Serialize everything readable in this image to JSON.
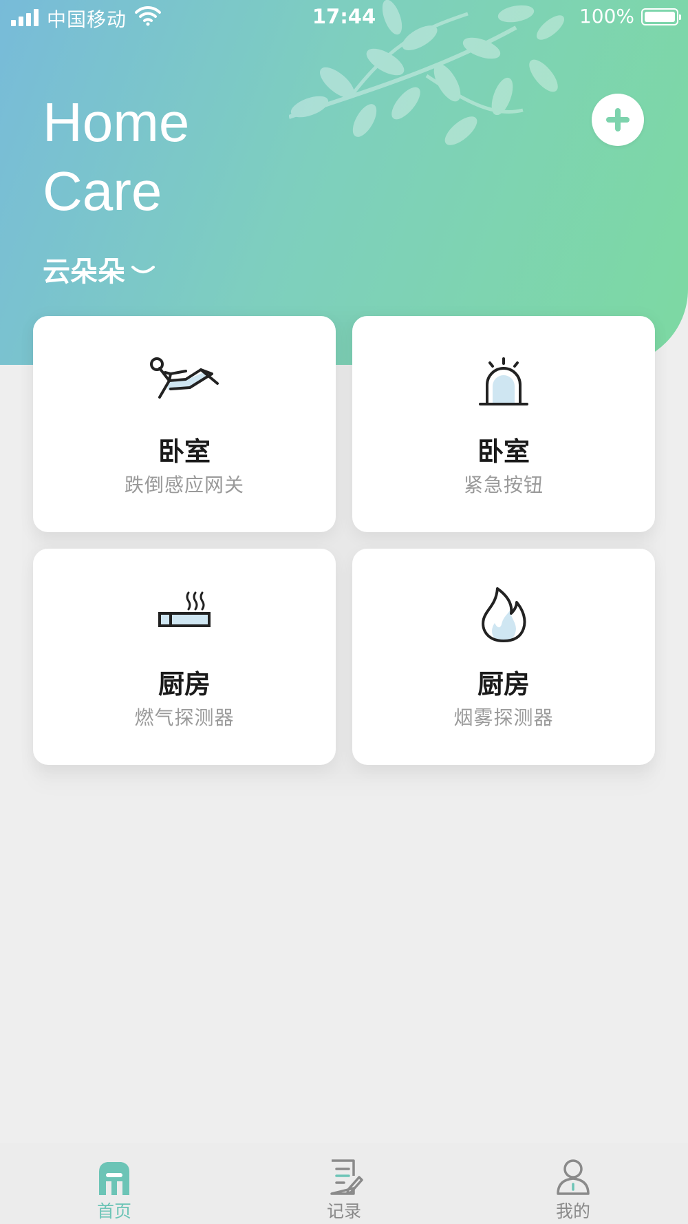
{
  "status_bar": {
    "carrier": "中国移动",
    "time": "17:44",
    "battery": "100%"
  },
  "header": {
    "title_line1": "Home",
    "title_line2": "Care",
    "user_name": "云朵朵",
    "add_icon": "plus-icon"
  },
  "devices": [
    {
      "room": "卧室",
      "device": "跌倒感应网关",
      "icon": "fall-detection-icon"
    },
    {
      "room": "卧室",
      "device": "紧急按钮",
      "icon": "alarm-light-icon"
    },
    {
      "room": "厨房",
      "device": "燃气探测器",
      "icon": "gas-cigarette-icon"
    },
    {
      "room": "厨房",
      "device": "烟雾探测器",
      "icon": "flame-icon"
    }
  ],
  "tabbar": {
    "items": [
      {
        "label": "首页",
        "icon": "home-icon",
        "active": true
      },
      {
        "label": "记录",
        "icon": "records-icon",
        "active": false
      },
      {
        "label": "我的",
        "icon": "profile-icon",
        "active": false
      }
    ]
  },
  "colors": {
    "gradient_start": "#78bbd9",
    "gradient_end": "#7dd9a2",
    "accent": "#6cc4b6",
    "icon_light_blue": "#cfe6f2"
  }
}
